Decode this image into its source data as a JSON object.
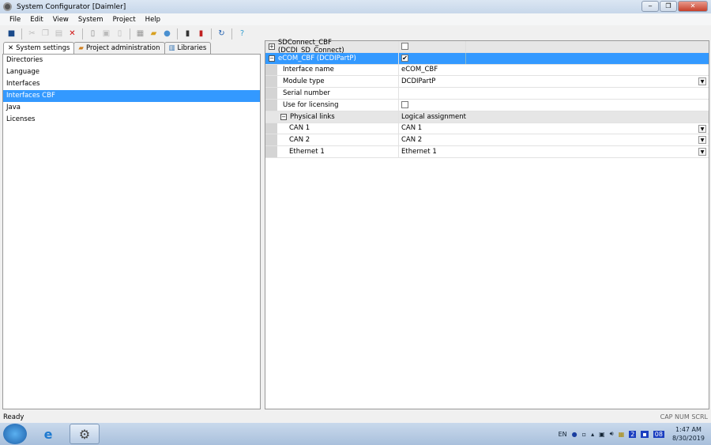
{
  "window": {
    "title": "System Configurator [Daimler]",
    "buttons": [
      "minimize",
      "maximize",
      "close"
    ]
  },
  "menu": [
    "File",
    "Edit",
    "View",
    "System",
    "Project",
    "Help"
  ],
  "toolbar": [
    "save-icon",
    "cut-icon",
    "copy-icon",
    "paste-icon",
    "delete-icon",
    "new-icon",
    "save-as-icon",
    "export-icon",
    "settings-icon",
    "project-icon",
    "install-icon",
    "book-icon",
    "remove-icon",
    "refresh-icon",
    "help-icon"
  ],
  "tabs": [
    {
      "label": "System settings",
      "active": true
    },
    {
      "label": "Project administration"
    },
    {
      "label": "Libraries"
    }
  ],
  "left_list": {
    "items": [
      "Directories",
      "Language",
      "Interfaces",
      "Interfaces CBF",
      "Java",
      "Licenses"
    ],
    "selected": "Interfaces CBF"
  },
  "grid": {
    "interfaces": [
      {
        "label": "SDConnect_CBF (DCDI_SD_Connect)",
        "checked": false,
        "expanded": false
      },
      {
        "label": "eCOM_CBF (DCDIPartP)",
        "checked": true,
        "expanded": true
      }
    ],
    "properties": [
      {
        "label": "Interface name",
        "value": "eCOM_CBF"
      },
      {
        "label": "Module type",
        "value": "DCDIPartP",
        "dropdown": true
      },
      {
        "label": "Serial number",
        "value": ""
      },
      {
        "label": "Use for licensing",
        "checked": false
      }
    ],
    "links_header": {
      "label": "Physical links",
      "value": "Logical assignment"
    },
    "links": [
      {
        "label": "CAN 1",
        "value": "CAN 1"
      },
      {
        "label": "CAN 2",
        "value": "CAN 2"
      },
      {
        "label": "Ethernet 1",
        "value": "Ethernet 1"
      }
    ]
  },
  "status": {
    "text": "Ready",
    "indicators": "CAP NUM SCRL"
  },
  "taskbar": {
    "lang": "EN",
    "time": "1:47 AM",
    "date": "8/30/2019",
    "tray_num": "08"
  }
}
